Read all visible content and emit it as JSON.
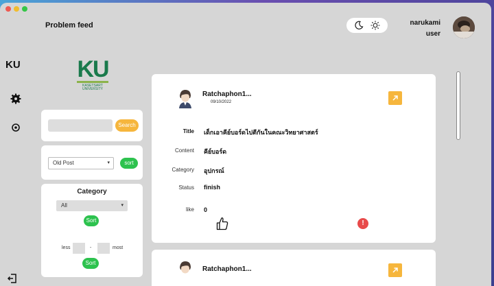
{
  "header": {
    "title": "Problem feed",
    "user_name": "narukami",
    "user_role": "user"
  },
  "rail": {
    "logo": "KU"
  },
  "brand": {
    "letters": "KU",
    "subtitle_line1": "KASETSART",
    "subtitle_line2": "UNIVERSITY"
  },
  "search": {
    "value": "",
    "button_label": "Search"
  },
  "sort": {
    "selected": "Old Post",
    "button_label": "sort"
  },
  "category": {
    "title": "Category",
    "selected": "All",
    "sort_label": "Sort",
    "range_less": "less",
    "range_dash": "-",
    "range_most": "most",
    "range_sort_label": "Sort"
  },
  "posts": [
    {
      "author": "Ratchaphon1...",
      "date": "09/10/2022",
      "labels": {
        "title": "Title",
        "content": "Content",
        "category": "Category",
        "status": "Status",
        "like": "like"
      },
      "title": "เด็กเอาคีย์บอร์ดไปตีกันในคณะวิทยาศาสตร์",
      "content": "คีย์บอร์ด",
      "category": "อุปกรณ์",
      "status": "finish",
      "like_count": "0"
    },
    {
      "author": "Ratchaphon1..."
    }
  ],
  "colors": {
    "accent_orange": "#f6b63d",
    "accent_green": "#2dc24e",
    "brand_green": "#1a7a4c",
    "report_red": "#e84a4a"
  }
}
